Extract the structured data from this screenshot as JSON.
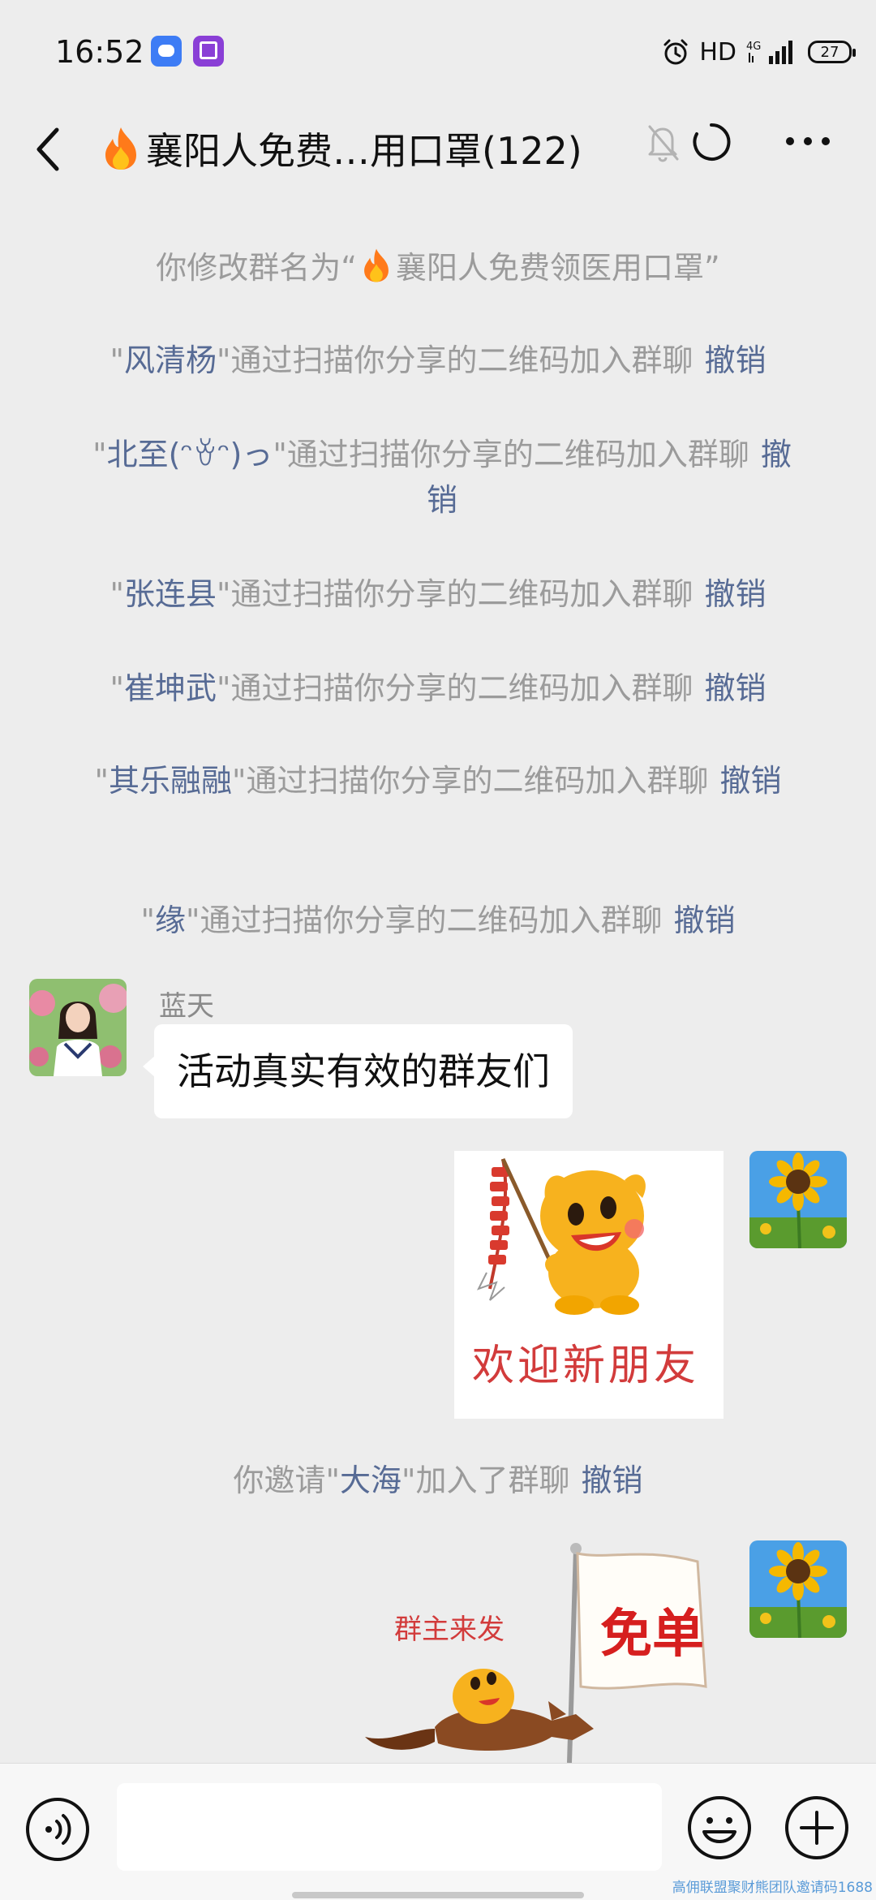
{
  "status_bar": {
    "time": "16:52",
    "hd": "HD",
    "network": "4G",
    "battery": "27"
  },
  "header": {
    "title": "襄阳人免费…用口罩(122)",
    "icons": [
      "back-icon",
      "fire-icon",
      "mute-bell-icon",
      "loading-icon",
      "more-icon"
    ]
  },
  "messages": {
    "rename": {
      "prefix": "你修改群名为“",
      "group_name": "襄阳人免费领医用口罩",
      "suffix": "”"
    },
    "joins": [
      {
        "quote_open": "\"",
        "name": "风清杨",
        "text": "\"通过扫描你分享的二维码加入群聊",
        "revoke": "撤销"
      },
      {
        "quote_open": "\"",
        "name": "北至(ᵔꈊᵔ)っ",
        "text": "\"通过扫描你分享的二维码加入群聊",
        "revoke": "撤销"
      },
      {
        "quote_open": "\"",
        "name": "张连县",
        "text": "\"通过扫描你分享的二维码加入群聊",
        "revoke": "撤销"
      },
      {
        "quote_open": "\"",
        "name": "崔坤武",
        "text": "\"通过扫描你分享的二维码加入群聊",
        "revoke": "撤销"
      },
      {
        "quote_open": "\"",
        "name": "其乐融融",
        "text": "\"通过扫描你分享的二维码加入群聊",
        "revoke": "撤销"
      },
      {
        "quote_open": "\"",
        "name": "缘",
        "text": "\"通过扫描你分享的二维码加入群聊",
        "revoke": "撤销"
      }
    ],
    "incoming": {
      "sender": "蓝天",
      "text": "活动真实有效的群友们"
    },
    "sticker1": {
      "caption": "欢迎新朋友"
    },
    "invite": {
      "prefix": "你邀请\"",
      "name": "大海",
      "suffix": "\"加入了群聊",
      "revoke": "撤销"
    },
    "sticker2": {
      "caption_left": "群主来发",
      "flag_text": "免单"
    }
  },
  "input_bar": {
    "placeholder": "",
    "icons": [
      "voice-icon",
      "emoji-icon",
      "plus-icon"
    ]
  },
  "watermark": "高佣联盟聚财熊团队邀请码1688",
  "colors": {
    "background": "#ededed",
    "link": "#576b95",
    "system_text": "#9b9b9b",
    "bubble": "#ffffff"
  }
}
